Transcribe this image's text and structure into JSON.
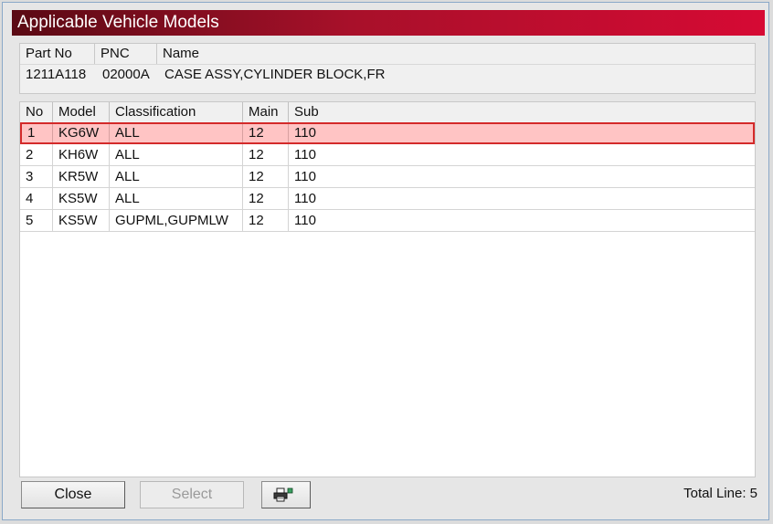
{
  "window": {
    "title": "Applicable Vehicle Models"
  },
  "part": {
    "headers": [
      "Part No",
      "PNC",
      "Name"
    ],
    "part_no": "1211A118",
    "pnc": "02000A",
    "name": "CASE ASSY,CYLINDER BLOCK,FR"
  },
  "grid": {
    "headers": [
      "No",
      "Model",
      "Classification",
      "Main",
      "Sub"
    ],
    "rows": [
      {
        "no": "1",
        "model": "KG6W",
        "classification": "ALL",
        "main": "12",
        "sub": "110",
        "selected": true
      },
      {
        "no": "2",
        "model": "KH6W",
        "classification": "ALL",
        "main": "12",
        "sub": "110",
        "selected": false
      },
      {
        "no": "3",
        "model": "KR5W",
        "classification": "ALL",
        "main": "12",
        "sub": "110",
        "selected": false
      },
      {
        "no": "4",
        "model": "KS5W",
        "classification": "ALL",
        "main": "12",
        "sub": "110",
        "selected": false
      },
      {
        "no": "5",
        "model": "KS5W",
        "classification": "GUPML,GUPMLW",
        "main": "12",
        "sub": "110",
        "selected": false
      }
    ]
  },
  "footer": {
    "close_label": "Close",
    "select_label": "Select",
    "print_icon": "printer-icon",
    "total_text": "Total Line: 5"
  },
  "colors": {
    "title_gradient_start": "#5a0a14",
    "title_gradient_end": "#d60a34",
    "selected_row_bg": "#ffc4c4",
    "selected_row_border": "#d42a2a"
  }
}
